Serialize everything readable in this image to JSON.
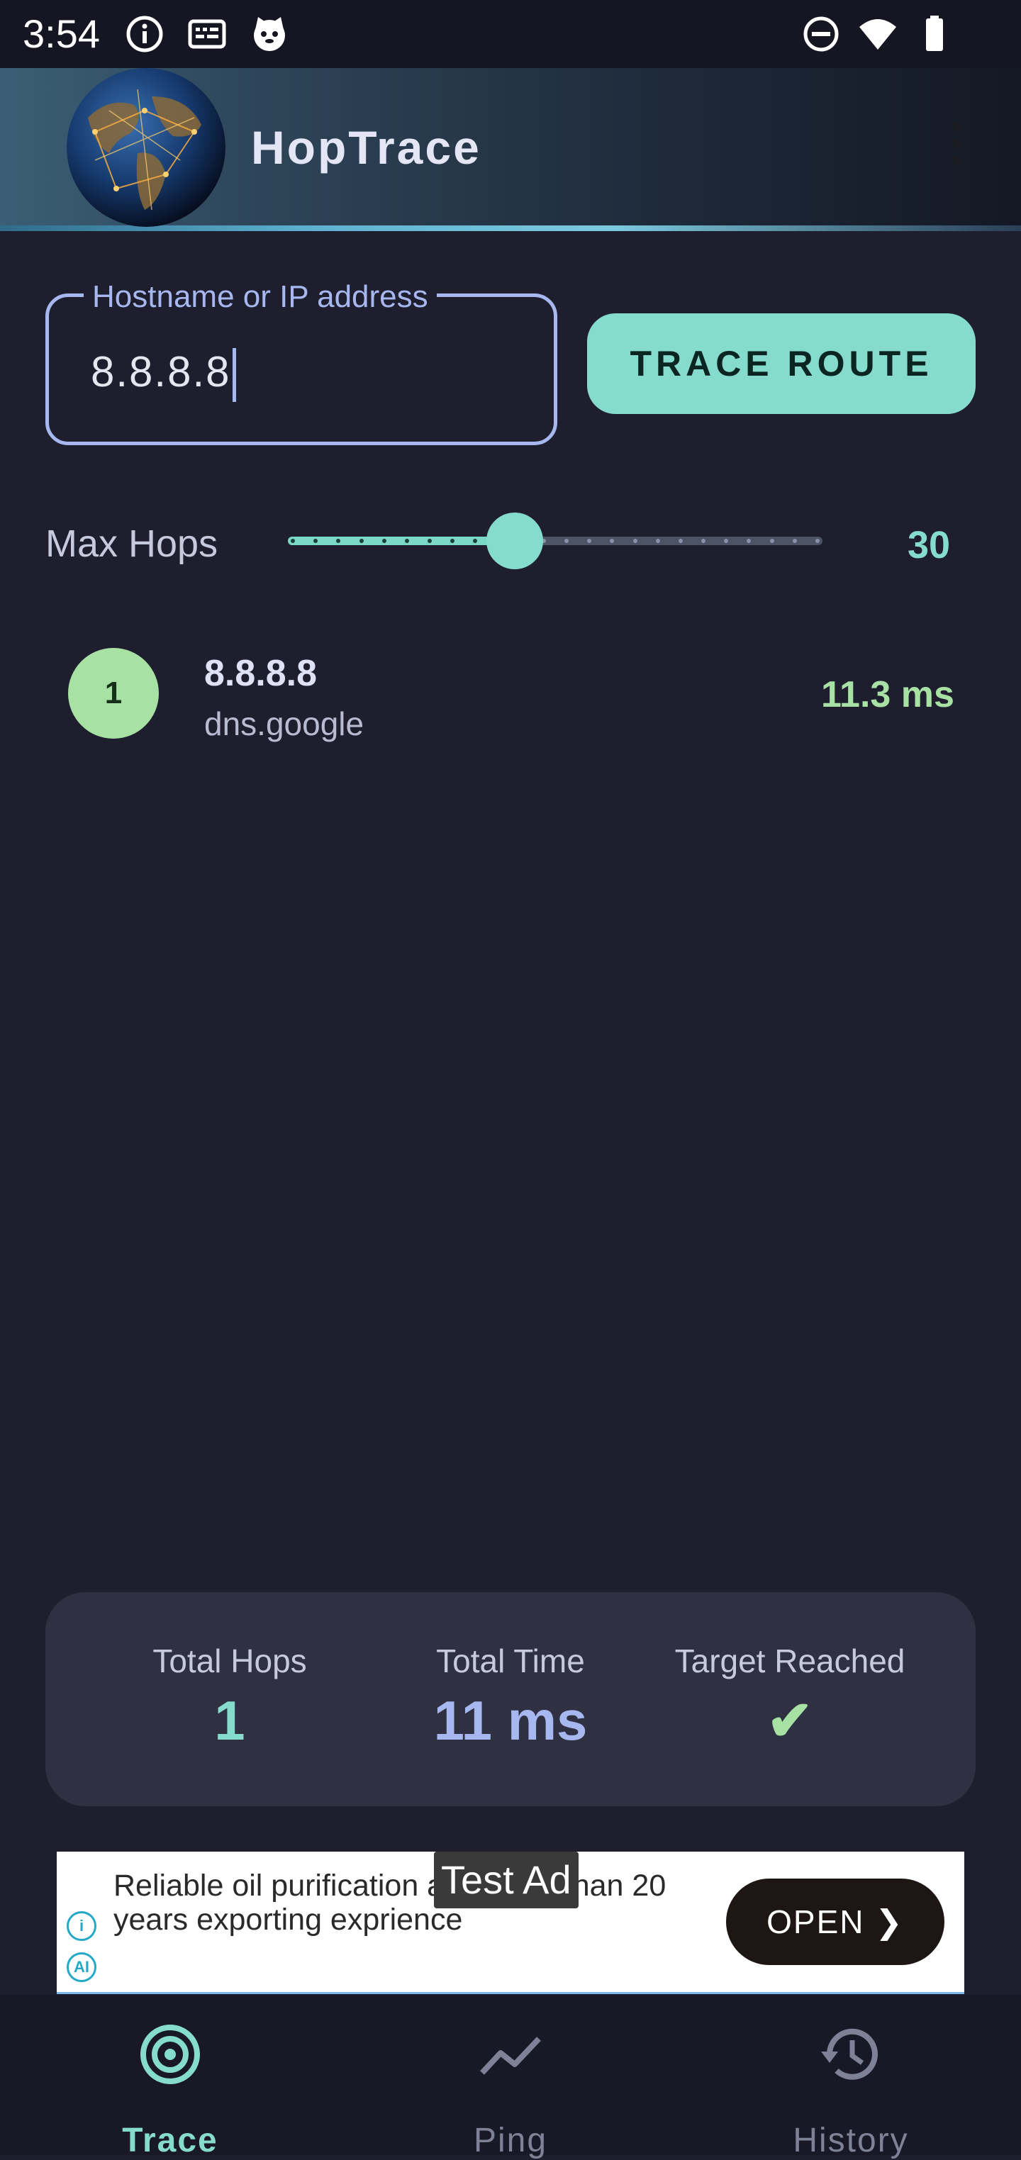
{
  "status_bar": {
    "time": "3:54",
    "left_icons": [
      "info-icon",
      "keyboard-icon",
      "cat-face-icon"
    ],
    "right_icons": [
      "do-not-disturb-icon",
      "wifi-icon",
      "battery-icon"
    ]
  },
  "app_bar": {
    "title": "HopTrace",
    "logo": "globe-logo",
    "menu_icon": "overflow-menu-icon"
  },
  "trace_form": {
    "field_label": "Hostname or IP address",
    "field_value": "8.8.8.8",
    "button_label": "TRACE ROUTE"
  },
  "max_hops": {
    "label": "Max Hops",
    "value": "30",
    "min": 1,
    "max": 64,
    "current": 30
  },
  "hops": [
    {
      "number": "1",
      "ip": "8.8.8.8",
      "host": "dns.google",
      "time": "11.3 ms"
    }
  ],
  "summary": {
    "total_hops_label": "Total Hops",
    "total_hops_value": "1",
    "total_time_label": "Total Time",
    "total_time_value": "11 ms",
    "target_reached_label": "Target Reached",
    "target_reached_value": "✔"
  },
  "ad": {
    "tag": "Test Ad",
    "text": "Reliable oil purification and more than 20 years exporting exprience",
    "button": "OPEN",
    "icons": [
      "info-icon",
      "ai-icon"
    ]
  },
  "bottom_nav": {
    "items": [
      {
        "label": "Trace",
        "icon": "target-icon",
        "active": true
      },
      {
        "label": "Ping",
        "icon": "trend-line-icon",
        "active": false
      },
      {
        "label": "History",
        "icon": "history-icon",
        "active": false
      }
    ]
  },
  "colors": {
    "background": "#1e1e2f",
    "accent_teal": "#86dccc",
    "accent_blue": "#a6b8ef",
    "success_green": "#a7e1a3",
    "card": "#2f3042"
  }
}
